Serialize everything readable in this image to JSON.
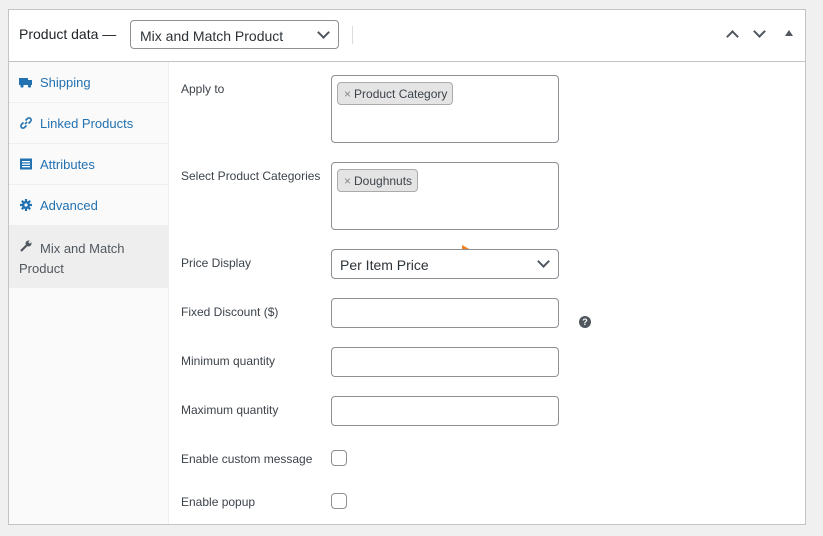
{
  "header": {
    "title": "Product data —",
    "product_type": "Mix and Match Product"
  },
  "sidebar": {
    "items": [
      {
        "label": "Shipping",
        "icon": "truck-icon"
      },
      {
        "label": "Linked Products",
        "icon": "link-icon"
      },
      {
        "label": "Attributes",
        "icon": "list-icon"
      },
      {
        "label": "Advanced",
        "icon": "gear-icon"
      },
      {
        "label": "Mix and Match Product",
        "icon": "wrench-icon"
      }
    ]
  },
  "fields": {
    "apply_to": {
      "label": "Apply to",
      "chip": "Product Category",
      "remove": "×"
    },
    "categories": {
      "label": "Select Product Categories",
      "chip": "Doughnuts",
      "remove": "×"
    },
    "price_display": {
      "label": "Price Display",
      "value": "Per Item Price"
    },
    "fixed_discount": {
      "label": "Fixed Discount ($)",
      "value": "",
      "help": "?"
    },
    "min_qty": {
      "label": "Minimum quantity",
      "value": ""
    },
    "max_qty": {
      "label": "Maximum quantity",
      "value": ""
    },
    "custom_message": {
      "label": "Enable custom message",
      "checked": false
    },
    "popup": {
      "label": "Enable popup",
      "checked": false
    }
  },
  "colors": {
    "link": "#2271b1",
    "arrow": "#f7801e",
    "border": "#c3c4c7"
  }
}
